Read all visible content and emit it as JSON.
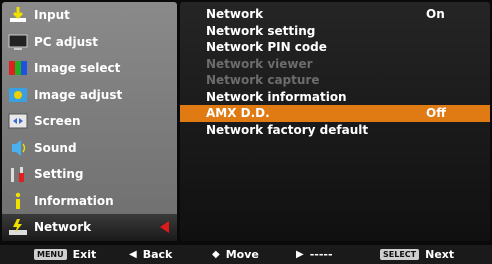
{
  "sidebar": {
    "items": [
      {
        "label": "Input",
        "icon": "input-icon"
      },
      {
        "label": "PC adjust",
        "icon": "pc-adjust-icon"
      },
      {
        "label": "Image select",
        "icon": "image-select-icon"
      },
      {
        "label": "Image adjust",
        "icon": "image-adjust-icon"
      },
      {
        "label": "Screen",
        "icon": "screen-icon"
      },
      {
        "label": "Sound",
        "icon": "sound-icon"
      },
      {
        "label": "Setting",
        "icon": "setting-icon"
      },
      {
        "label": "Information",
        "icon": "information-icon"
      },
      {
        "label": "Network",
        "icon": "network-icon"
      }
    ],
    "active_index": 8
  },
  "menu": {
    "rows": [
      {
        "label": "Network",
        "value": "On",
        "state": "normal"
      },
      {
        "label": "Network setting",
        "value": "",
        "state": "normal"
      },
      {
        "label": "Network PIN code",
        "value": "",
        "state": "normal"
      },
      {
        "label": "Network viewer",
        "value": "",
        "state": "disabled"
      },
      {
        "label": "Network capture",
        "value": "",
        "state": "disabled"
      },
      {
        "label": "Network information",
        "value": "",
        "state": "normal"
      },
      {
        "label": "AMX D.D.",
        "value": "Off",
        "state": "selected"
      },
      {
        "label": "Network factory default",
        "value": "",
        "state": "normal"
      }
    ]
  },
  "footer": {
    "menu_key": "MENU",
    "exit": "Exit",
    "back": "Back",
    "move": "Move",
    "dashes": "-----",
    "select_key": "SELECT",
    "next": "Next"
  },
  "colors": {
    "selected": "#e07a12",
    "pointer": "#e01a1a"
  }
}
